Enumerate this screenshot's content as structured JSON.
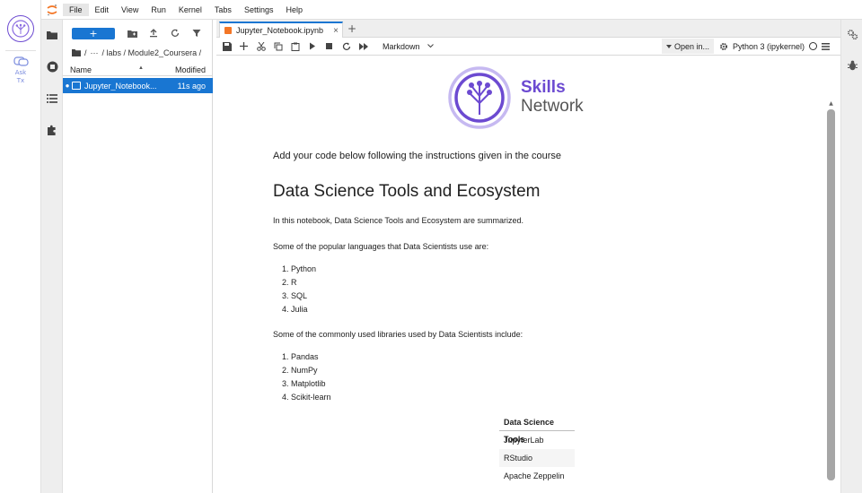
{
  "menu": {
    "items": [
      "File",
      "Edit",
      "View",
      "Run",
      "Kernel",
      "Tabs",
      "Settings",
      "Help"
    ],
    "active": "File"
  },
  "skills_rail": {
    "ask_label_line1": "Ask",
    "ask_label_line2": "Tx"
  },
  "filebrowser": {
    "new_button": "+",
    "breadcrumb": [
      "/",
      "···",
      "/ labs / Module2_Coursera /"
    ],
    "columns": {
      "name": "Name",
      "modified": "Modified"
    },
    "files": [
      {
        "name": "Jupyter_Notebook...",
        "modified": "11s ago"
      }
    ]
  },
  "tabs": {
    "active_tab": "Jupyter_Notebook.ipynb",
    "close": "×",
    "add": "+"
  },
  "toolbar": {
    "cell_type": "Markdown",
    "open_in": "Open in...",
    "kernel": "Python 3 (ipykernel)"
  },
  "notebook": {
    "logo_line1": "Skills",
    "logo_line2": "Network",
    "instruction": "Add your code below following the instructions given in the course",
    "title": "Data Science Tools and Ecosystem",
    "intro": "In this notebook, Data Science Tools and Ecosystem are summarized.",
    "languages_intro": "Some of the popular languages that Data Scientists use are:",
    "languages": [
      "1. Python",
      "2. R",
      "3. SQL",
      "4. Julia"
    ],
    "libraries_intro": "Some of the commonly used libraries used by Data Scientists include:",
    "libraries": [
      "1. Pandas",
      "2. NumPy",
      "3. Matplotlib",
      "4. Scikit-learn"
    ],
    "table": {
      "header": "Data Science Tools",
      "rows": [
        "JupyterLab",
        "RStudio",
        "Apache Zeppelin"
      ]
    }
  },
  "colors": {
    "accent": "#1976d2",
    "brand_purple": "#6c4ad1",
    "jupyter_orange": "#f37626"
  }
}
